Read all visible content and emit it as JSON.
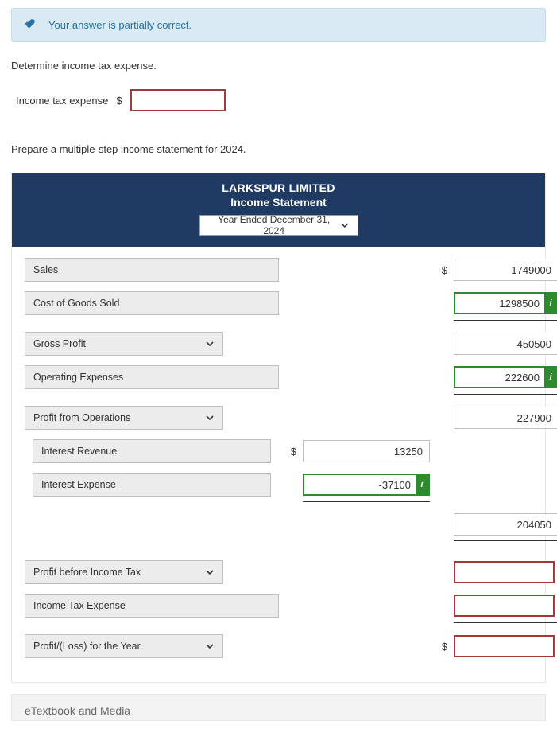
{
  "feedback": {
    "text": "Your answer is partially correct."
  },
  "prompt1": "Determine income tax expense.",
  "topInput": {
    "label": "Income tax expense",
    "currency": "$",
    "value": ""
  },
  "prompt2": "Prepare a multiple-step income statement for 2024.",
  "statement": {
    "company": "LARKSPUR LIMITED",
    "title": "Income Statement",
    "period": "Year Ended December 31, 2024",
    "currency": "$",
    "rows": {
      "sales": {
        "label": "Sales",
        "value": "1749000"
      },
      "cogs": {
        "label": "Cost of Goods Sold",
        "value": "1298500"
      },
      "gross": {
        "label": "Gross Profit",
        "value": "450500"
      },
      "opex": {
        "label": "Operating Expenses",
        "value": "222600"
      },
      "opsprofit": {
        "label": "Profit from Operations",
        "value": "227900"
      },
      "intrev": {
        "label": "Interest Revenue",
        "value": "13250"
      },
      "intexp": {
        "label": "Interest Expense",
        "value": "-37100"
      },
      "subtotal2": {
        "value": "204050"
      },
      "pbt": {
        "label": "Profit before Income Tax",
        "value": ""
      },
      "taxexp": {
        "label": "Income Tax Expense",
        "value": ""
      },
      "ploss": {
        "label": "Profit/(Loss) for the Year",
        "value": ""
      }
    }
  },
  "footer": {
    "etext": "eTextbook and Media"
  }
}
